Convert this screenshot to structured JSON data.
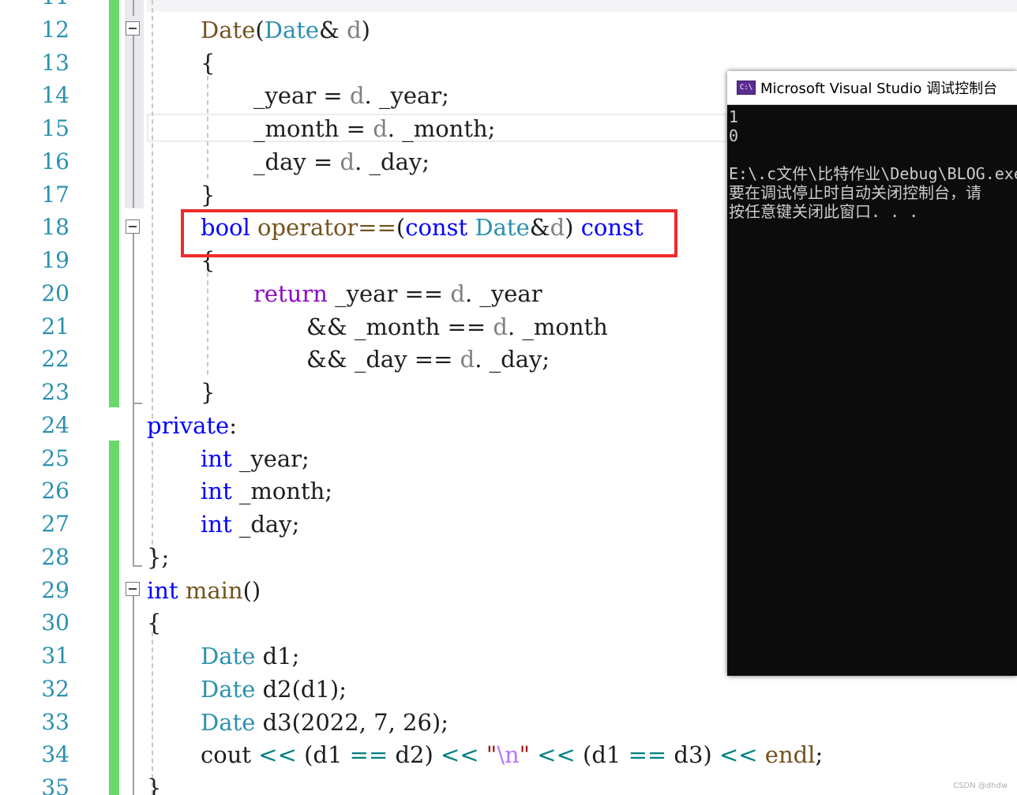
{
  "editor": {
    "line_numbers": [
      "11",
      "12",
      "13",
      "14",
      "15",
      "16",
      "17",
      "18",
      "19",
      "20",
      "21",
      "22",
      "23",
      "24",
      "25",
      "26",
      "27",
      "28",
      "29",
      "30",
      "31",
      "32",
      "33",
      "34",
      "35"
    ],
    "code_lines": [
      {
        "n": "12",
        "segs": [
          [
            "fn",
            "Date"
          ],
          [
            "",
            "("
          ],
          [
            "ty",
            "Date"
          ],
          [
            "",
            "& "
          ],
          [
            "pm",
            "d"
          ],
          [
            "",
            ")"
          ]
        ]
      },
      {
        "n": "13",
        "segs": [
          [
            "",
            "{"
          ]
        ]
      },
      {
        "n": "14",
        "segs": [
          [
            "",
            "_year = "
          ],
          [
            "pm",
            "d"
          ],
          [
            "",
            ". _year;"
          ]
        ]
      },
      {
        "n": "15",
        "segs": [
          [
            "",
            "_month = "
          ],
          [
            "pm",
            "d"
          ],
          [
            "",
            ". _month;"
          ]
        ]
      },
      {
        "n": "16",
        "segs": [
          [
            "",
            "_day = "
          ],
          [
            "pm",
            "d"
          ],
          [
            "",
            ". _day;"
          ]
        ]
      },
      {
        "n": "17",
        "segs": [
          [
            "",
            "}"
          ]
        ]
      },
      {
        "n": "18",
        "segs": [
          [
            "kw",
            "bool"
          ],
          [
            "",
            " "
          ],
          [
            "fn",
            "operator=="
          ],
          [
            "",
            "("
          ],
          [
            "kw",
            "const"
          ],
          [
            "",
            " "
          ],
          [
            "ty",
            "Date"
          ],
          [
            "",
            "&"
          ],
          [
            "pm",
            "d"
          ],
          [
            "",
            ") "
          ],
          [
            "kw",
            "const"
          ]
        ]
      },
      {
        "n": "19",
        "segs": [
          [
            "",
            "{"
          ]
        ]
      },
      {
        "n": "20",
        "segs": [
          [
            "ct",
            "return"
          ],
          [
            "",
            " _year == "
          ],
          [
            "pm",
            "d"
          ],
          [
            "",
            ". _year"
          ]
        ]
      },
      {
        "n": "21",
        "segs": [
          [
            "",
            "&& _month == "
          ],
          [
            "pm",
            "d"
          ],
          [
            "",
            ". _month"
          ]
        ]
      },
      {
        "n": "22",
        "segs": [
          [
            "",
            "&& _day == "
          ],
          [
            "pm",
            "d"
          ],
          [
            "",
            ". _day;"
          ]
        ]
      },
      {
        "n": "23",
        "segs": [
          [
            "",
            "}"
          ]
        ]
      },
      {
        "n": "24",
        "segs": [
          [
            "kw",
            "private"
          ],
          [
            "",
            ":"
          ]
        ]
      },
      {
        "n": "25",
        "segs": [
          [
            "kw",
            "int"
          ],
          [
            "",
            " _year;"
          ]
        ]
      },
      {
        "n": "26",
        "segs": [
          [
            "kw",
            "int"
          ],
          [
            "",
            " _month;"
          ]
        ]
      },
      {
        "n": "27",
        "segs": [
          [
            "kw",
            "int"
          ],
          [
            "",
            " _day;"
          ]
        ]
      },
      {
        "n": "28",
        "segs": [
          [
            "",
            "};"
          ]
        ]
      },
      {
        "n": "29",
        "segs": [
          [
            "kw",
            "int"
          ],
          [
            "",
            " "
          ],
          [
            "fn",
            "main"
          ],
          [
            "",
            "()"
          ]
        ]
      },
      {
        "n": "30",
        "segs": [
          [
            "",
            "{"
          ]
        ]
      },
      {
        "n": "31",
        "segs": [
          [
            "ty",
            "Date"
          ],
          [
            "",
            " d1;"
          ]
        ]
      },
      {
        "n": "32",
        "segs": [
          [
            "ty",
            "Date"
          ],
          [
            "",
            " d2(d1);"
          ]
        ]
      },
      {
        "n": "33",
        "segs": [
          [
            "ty",
            "Date"
          ],
          [
            "",
            " d3(2022, 7, 26);"
          ]
        ]
      },
      {
        "n": "34",
        "segs": [
          [
            "",
            "cout "
          ],
          [
            "op",
            "<<"
          ],
          [
            "",
            " (d1 "
          ],
          [
            "op",
            "=="
          ],
          [
            "",
            " d2) "
          ],
          [
            "op",
            "<<"
          ],
          [
            "",
            " "
          ],
          [
            "st",
            "\""
          ],
          [
            "esc",
            "\\n"
          ],
          [
            "st",
            "\""
          ],
          [
            "",
            " "
          ],
          [
            "op",
            "<<"
          ],
          [
            "",
            " (d1 "
          ],
          [
            "op",
            "=="
          ],
          [
            "",
            " d3) "
          ],
          [
            "op",
            "<<"
          ],
          [
            "",
            " "
          ],
          [
            "fn",
            "endl"
          ],
          [
            "",
            ";"
          ]
        ]
      },
      {
        "n": "35",
        "segs": [
          [
            "",
            "}"
          ]
        ]
      }
    ]
  },
  "console": {
    "title": "Microsoft Visual Studio 调试控制台",
    "icon_label": "C:\\",
    "icon": "console-app-icon",
    "output": "1\n0\n\nE:\\.c文件\\比特作业\\Debug\\BLOG.exe\n要在调试停止时自动关闭控制台，请\n按任意键关闭此窗口. . ."
  },
  "watermark": "CSDN @dhdw",
  "colors": {
    "keyword": "#0000ff",
    "type": "#2b91af",
    "function": "#74531f",
    "parameter": "#808080",
    "control": "#8f08c4",
    "change_bar": "#6ad86a",
    "highlight_box": "#ef2b2b",
    "console_bg": "#0c0c0c"
  }
}
